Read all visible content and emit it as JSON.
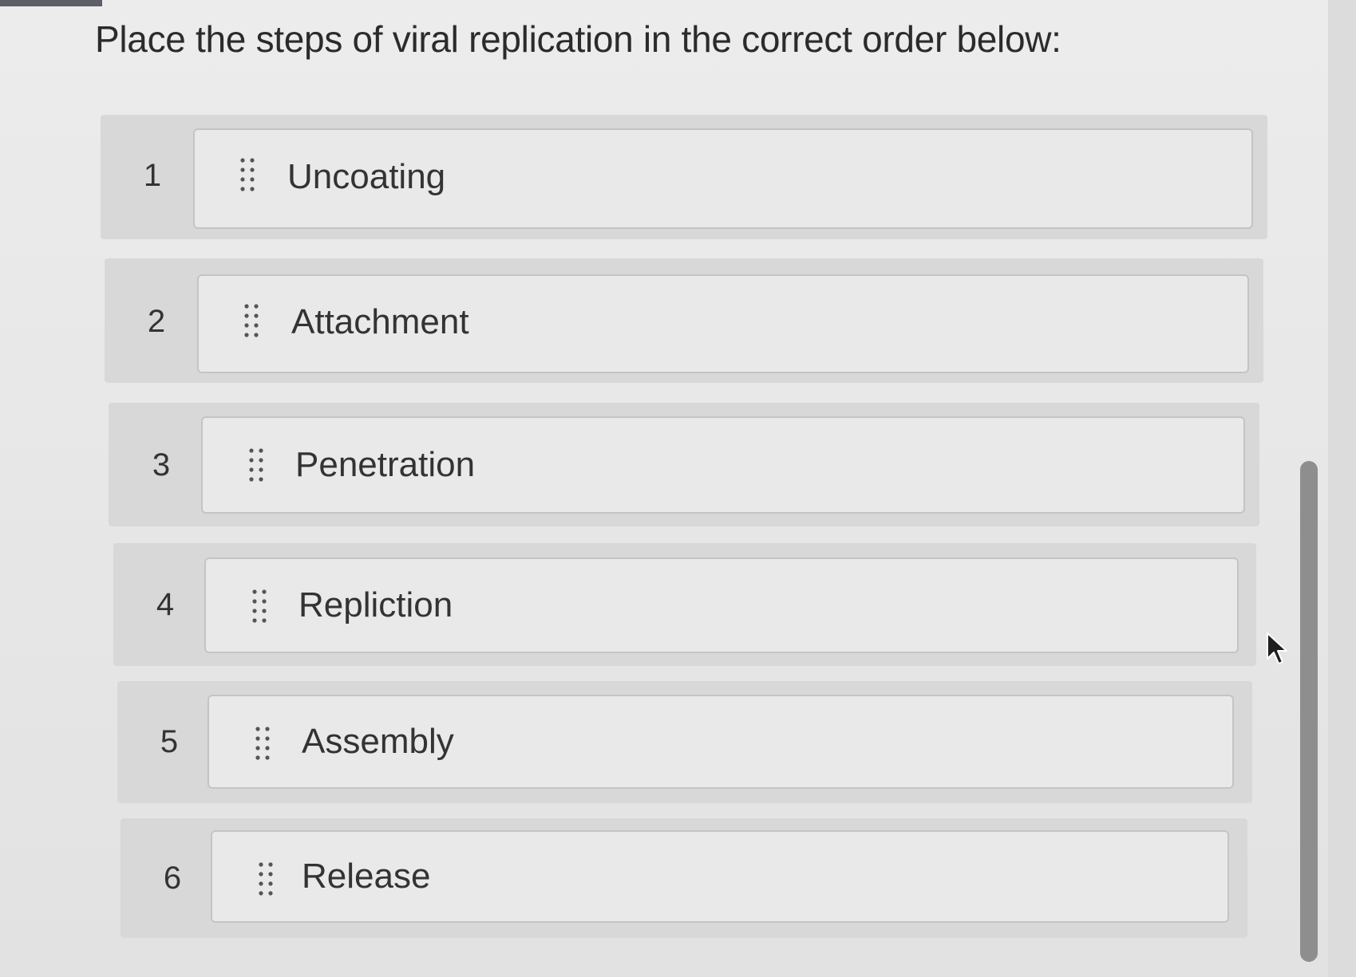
{
  "question": {
    "prompt": "Place the steps of viral replication in the correct order below:"
  },
  "order_list": {
    "items": [
      {
        "position": "1",
        "label": "Uncoating"
      },
      {
        "position": "2",
        "label": "Attachment"
      },
      {
        "position": "3",
        "label": "Penetration"
      },
      {
        "position": "4",
        "label": "Repliction"
      },
      {
        "position": "5",
        "label": "Assembly"
      },
      {
        "position": "6",
        "label": "Release"
      }
    ]
  },
  "icons": {
    "drag_handle": "drag-handle-icon",
    "cursor": "mouse-pointer-icon"
  },
  "colors": {
    "background": "#e9e9e9",
    "row_background": "#d8d8d8",
    "card_border": "#c4c4c4",
    "text": "#333333",
    "scrollbar": "#8e8e8e"
  }
}
